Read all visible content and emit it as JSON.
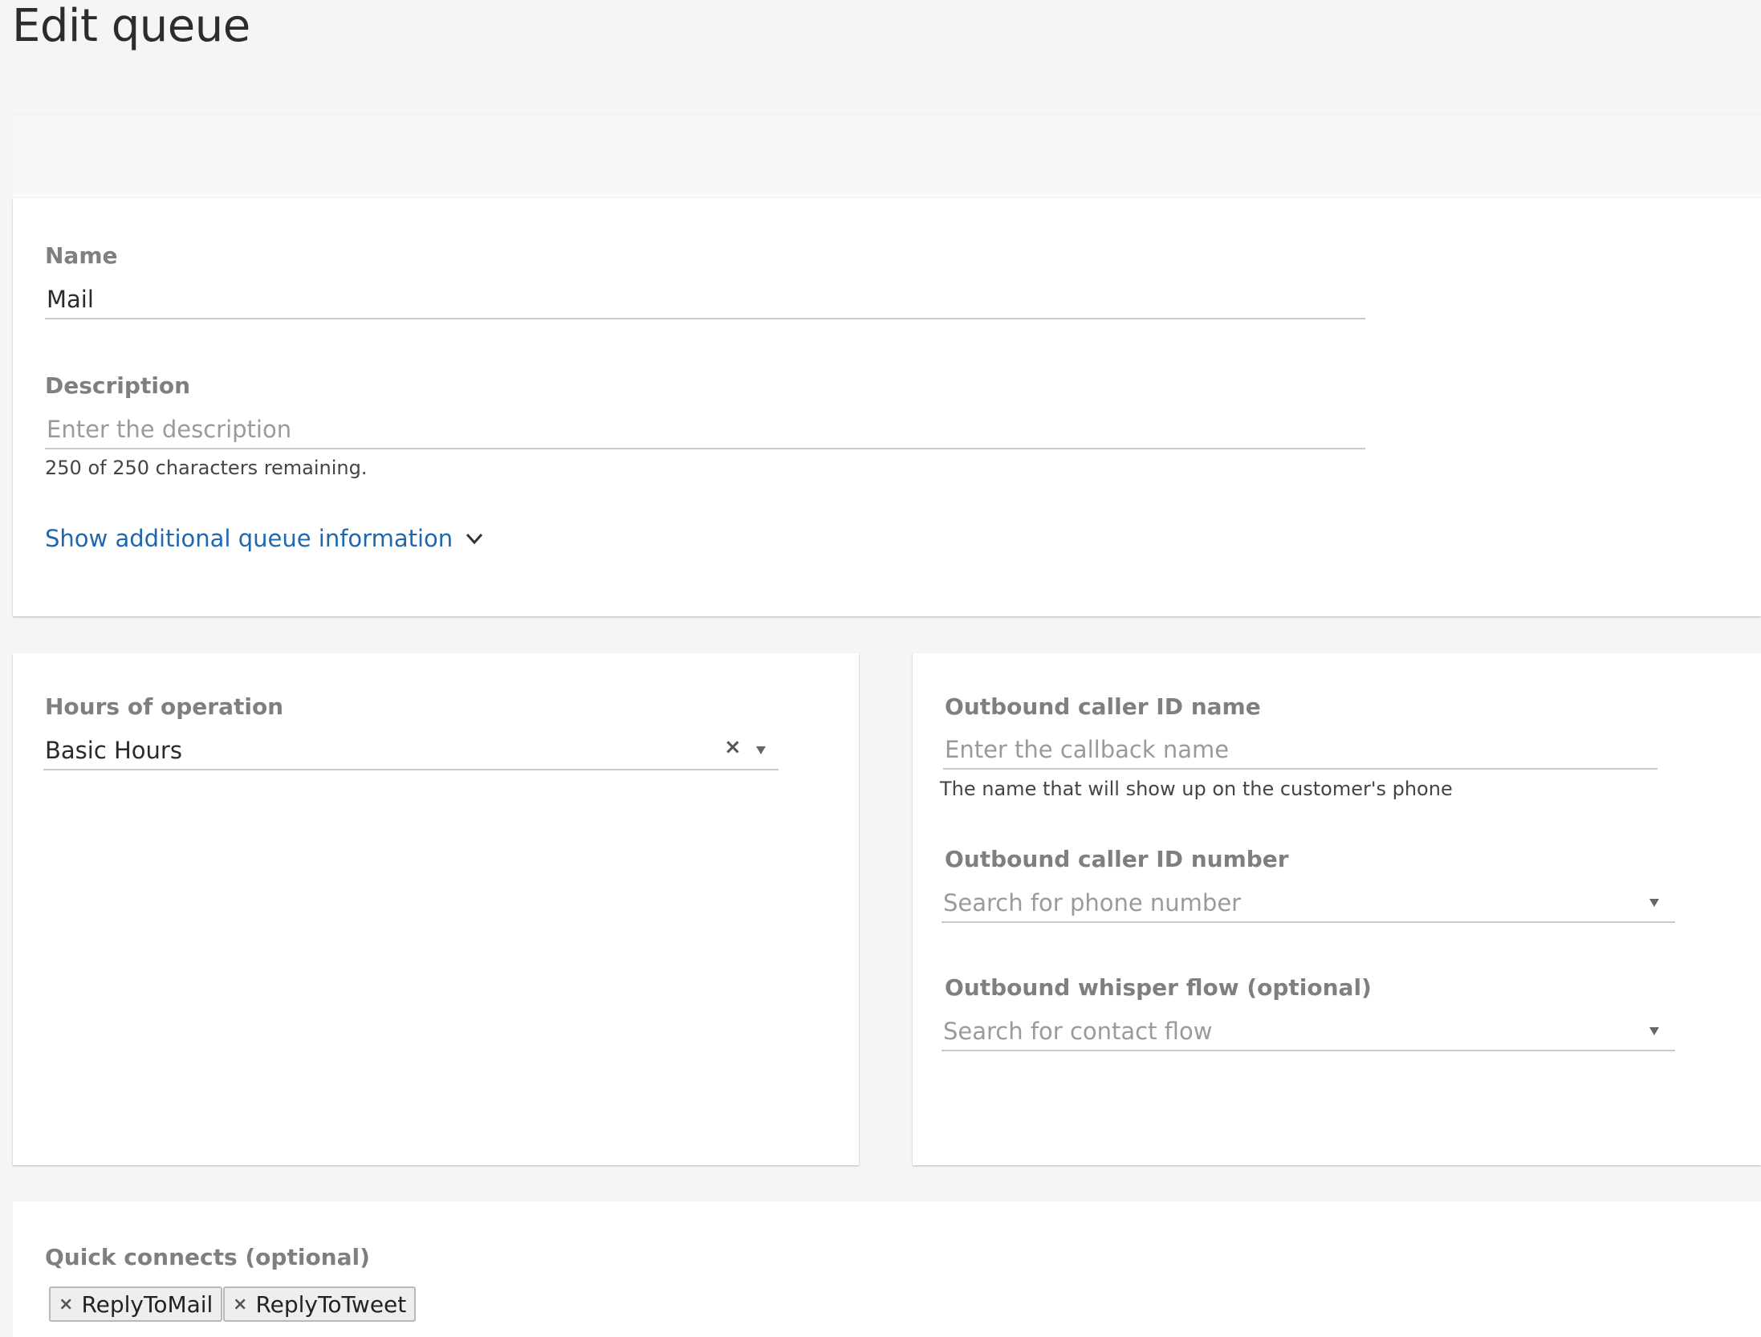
{
  "page": {
    "title": "Edit queue"
  },
  "name_field": {
    "label": "Name",
    "value": "Mail"
  },
  "description_field": {
    "label": "Description",
    "placeholder": "Enter the description",
    "hint": "250 of 250 characters remaining."
  },
  "additional_info": {
    "link_label": "Show additional queue information",
    "icon": "chevron-down-icon"
  },
  "hours": {
    "label": "Hours of operation",
    "value": "Basic Hours",
    "clear_icon": "×"
  },
  "outbound": {
    "caller_id_name": {
      "label": "Outbound caller ID name",
      "placeholder": "Enter the callback name",
      "hint": "The name that will show up on the customer's phone"
    },
    "caller_id_number": {
      "label": "Outbound caller ID number",
      "placeholder": "Search for phone number"
    },
    "whisper_flow": {
      "label": "Outbound whisper flow (optional)",
      "placeholder": "Search for contact flow"
    }
  },
  "quick_connects": {
    "label": "Quick connects (optional)",
    "chips": [
      {
        "label": "ReplyToMail",
        "remove_icon": "×"
      },
      {
        "label": "ReplyToTweet",
        "remove_icon": "×"
      }
    ]
  },
  "colors": {
    "link": "#1e68b0",
    "label": "#7f7f7f",
    "background": "#f5f5f5"
  }
}
